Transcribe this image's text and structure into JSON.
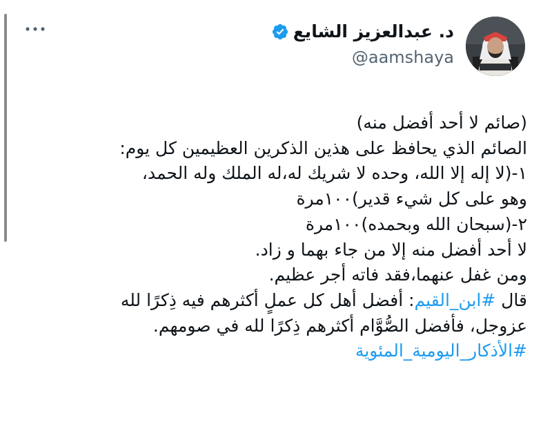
{
  "author": {
    "display_name": "د. عبدالعزيز الشايع",
    "handle": "@aamshaya",
    "verified_color": "#1d9bf0"
  },
  "more_menu_icon": "more-dots-icon",
  "tweet": {
    "lines": [
      "(صائم لا أحد أفضل منه)",
      "الصائم الذي يحافظ على هذين الذكرين العظيمين كل يوم:",
      "١-(لا إله إلا الله، وحده لا شريك له،له الملك وله الحمد،",
      "وهو على كل شيء قدير)١٠٠مرة",
      "٢-(سبحان الله وبحمده)١٠٠مرة",
      "لا أحد أفضل منه إلا من جاء بهما و زاد.",
      "ومن غفل عنهما،فقد فاته أجر عظيم."
    ],
    "quote_prefix": "قال ",
    "quote_hashtag": "#ابن_القيم",
    "quote_text": ": أفضل أهل كل عملٍ أكثرهم فيه ذِكرًا لله",
    "quote_line2": "عزوجل، فأفضل الصُّوَّام أكثرهم ذِكرًا لله في صومهم.",
    "final_hashtag": "#الأذكار_اليومية_المئوية"
  },
  "colors": {
    "text": "#0f1419",
    "secondary": "#536471",
    "link": "#1d9bf0"
  }
}
